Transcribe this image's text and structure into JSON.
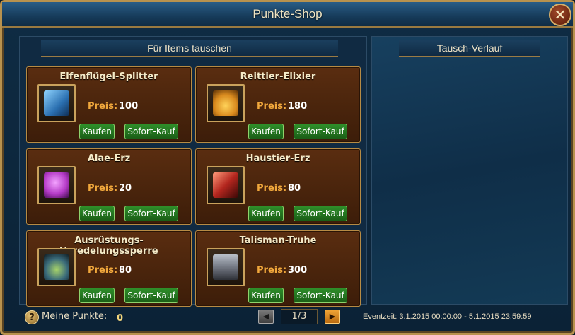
{
  "window": {
    "title": "Punkte-Shop",
    "close_glyph": "×"
  },
  "left_panel": {
    "header": "Für Items tauschen"
  },
  "right_panel": {
    "header": "Tausch-Verlauf"
  },
  "labels": {
    "price": "Preis:",
    "buy": "Kaufen",
    "instant_buy": "Sofort-Kauf"
  },
  "items": [
    {
      "name": "Elfenflügel-Splitter",
      "price": "100",
      "icon": "wing-shard-icon",
      "color": "#4aa0d8"
    },
    {
      "name": "Reittier-Elixier",
      "price": "180",
      "icon": "elixir-bottles-icon",
      "color": "#d98a1e"
    },
    {
      "name": "Alae-Erz",
      "price": "20",
      "icon": "purple-ore-icon",
      "color": "#b53bc7"
    },
    {
      "name": "Haustier-Erz",
      "price": "80",
      "icon": "red-ore-icon",
      "color": "#b3261e"
    },
    {
      "name": "Ausrüstungs-Veredelungssperre",
      "price": "80",
      "icon": "padlock-icon",
      "color": "#3a6a7a"
    },
    {
      "name": "Talisman-Truhe",
      "price": "300",
      "icon": "chest-icon",
      "color": "#7a7f8a"
    }
  ],
  "footer": {
    "help_glyph": "?",
    "points_label": "Meine Punkte:",
    "points_value": "0",
    "prev_glyph": "◀",
    "next_glyph": "▶",
    "page": "1/3",
    "event_time": "Eventzeit: 3.1.2015 00:00:00 - 5.1.2015 23:59:59"
  }
}
